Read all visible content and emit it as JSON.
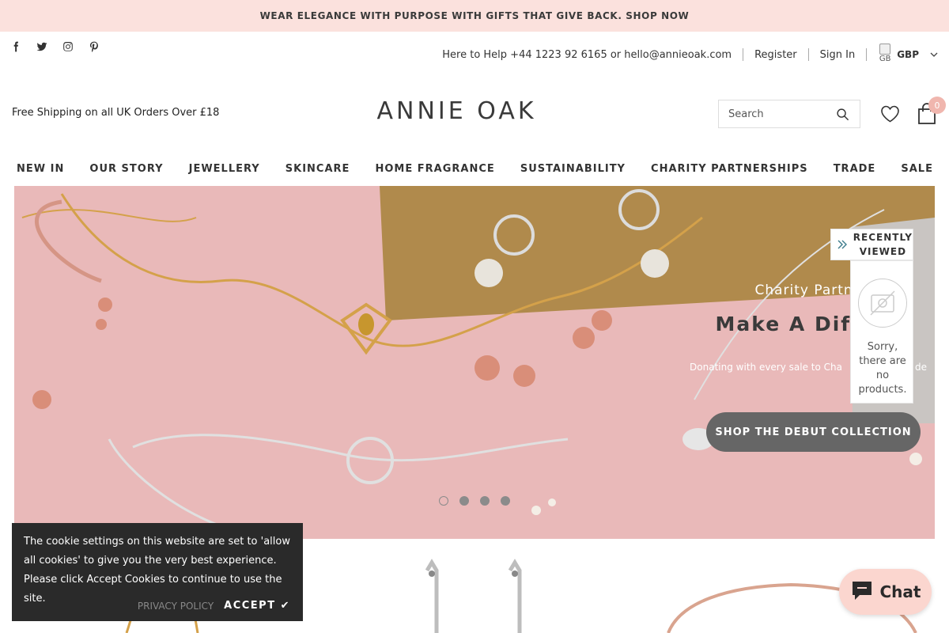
{
  "announcement": "WEAR ELEGANCE WITH PURPOSE WITH GIFTS THAT GIVE BACK. SHOP NOW",
  "social": [
    "facebook-icon",
    "twitter-icon",
    "instagram-icon",
    "pinterest-icon"
  ],
  "topbar": {
    "help": "Here to Help +44 1223 92 6165 or hello@annieoak.com",
    "register": "Register",
    "signin": "Sign In",
    "flag_alt": "GB",
    "currency": "GBP"
  },
  "header": {
    "free_shipping": "Free Shipping on all UK Orders Over £18",
    "logo": "ANNIE OAK",
    "search_placeholder": "Search",
    "cart_count": "0"
  },
  "nav": [
    "NEW IN",
    "OUR STORY",
    "JEWELLERY",
    "SKINCARE",
    "HOME FRAGRANCE",
    "SUSTAINABILITY",
    "CHARITY PARTNERSHIPS",
    "TRADE",
    "SALE"
  ],
  "hero": {
    "subtitle": "Charity Partners",
    "title": "Make A Diffe",
    "description": "Donating with every sale to Cha",
    "description_tail": "de",
    "cta": "SHOP THE DEBUT COLLECTION",
    "slides": 4,
    "active_slide": 1
  },
  "recently_viewed": {
    "label_line1": "RECENTLY",
    "label_line2": "VIEWED",
    "empty_line1": "Sorry,",
    "empty_line2": "there are",
    "empty_line3": "no",
    "empty_line4": "products."
  },
  "cookie": {
    "text": "The cookie settings on this website are set to 'allow all cookies' to give you the very best experience. Please click Accept Cookies to continue to use the site.",
    "privacy": "PRIVACY POLICY",
    "accept": "ACCEPT ✔"
  },
  "chat": {
    "label": "Chat"
  },
  "colors": {
    "announcement_bg": "#fbe1dd",
    "hero_bg": "#e7b8b8",
    "cta_bg": "#666666",
    "badge": "#f0b6ae",
    "cookie_bg": "#2a2a2a",
    "chat_bg": "#fbd6cf"
  }
}
